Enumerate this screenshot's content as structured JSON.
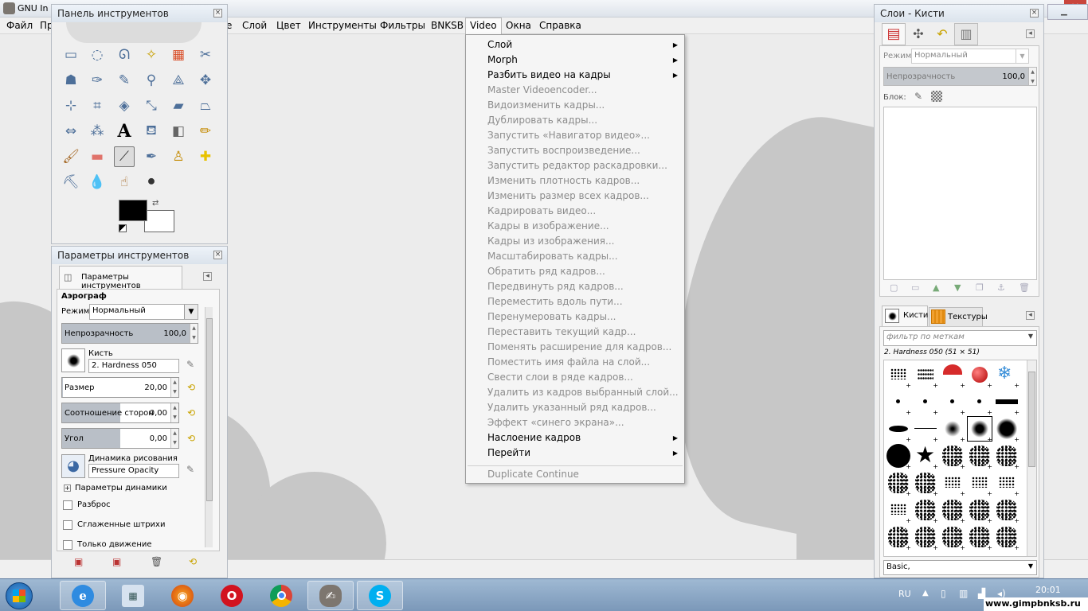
{
  "app": {
    "title": "GNU In",
    "menu": [
      "Файл",
      "Пр",
      "е",
      "Слой",
      "Цвет",
      "Инструменты",
      "Фильтры",
      "BNKSB",
      "Video",
      "Окна",
      "Справка"
    ]
  },
  "toolbox": {
    "title": "Панель инструментов",
    "close": "⊠"
  },
  "tool_options": {
    "title": "Параметры инструментов",
    "tab_label": "Параметры инструментов",
    "tool_name": "Аэрограф",
    "mode_label": "Режим:",
    "mode_value": "Нормальный",
    "opacity_label": "Непрозрачность",
    "opacity_value": "100,0",
    "brush_label": "Кисть",
    "brush_value": "2. Hardness 050",
    "size_label": "Размер",
    "size_value": "20,00",
    "aspect_label": "Соотношение сторон",
    "aspect_value": "0,00",
    "angle_label": "Угол",
    "angle_value": "0,00",
    "dynamics_label": "Динамика рисования",
    "dynamics_value": "Pressure Opacity",
    "dynamics_options_label": "Параметры динамики",
    "jitter_label": "Разброс",
    "smooth_label": "Сглаженные штрихи",
    "motion_label": "Только движение"
  },
  "video_menu": {
    "items": [
      {
        "label": "Слой",
        "enabled": true,
        "submenu": true
      },
      {
        "label": "Morph",
        "enabled": true,
        "submenu": true
      },
      {
        "label": "Разбить видео на кадры",
        "enabled": true,
        "submenu": true
      },
      {
        "label": "Master Videoencoder...",
        "enabled": false
      },
      {
        "label": "Видоизменить кадры...",
        "enabled": false
      },
      {
        "label": "Дублировать кадры...",
        "enabled": false
      },
      {
        "label": "Запустить «Навигатор видео»...",
        "enabled": false
      },
      {
        "label": "Запустить воспроизведение...",
        "enabled": false
      },
      {
        "label": "Запустить редактор раскадровки...",
        "enabled": false
      },
      {
        "label": "Изменить плотность кадров...",
        "enabled": false
      },
      {
        "label": "Изменить размер всех кадров...",
        "enabled": false
      },
      {
        "label": "Кадрировать видео...",
        "enabled": false
      },
      {
        "label": "Кадры в изображение...",
        "enabled": false
      },
      {
        "label": "Кадры из изображения...",
        "enabled": false
      },
      {
        "label": "Масштабировать кадры...",
        "enabled": false
      },
      {
        "label": "Обратить ряд кадров...",
        "enabled": false
      },
      {
        "label": "Передвинуть ряд кадров...",
        "enabled": false
      },
      {
        "label": "Переместить вдоль пути...",
        "enabled": false
      },
      {
        "label": "Перенумеровать кадры...",
        "enabled": false
      },
      {
        "label": "Переставить текущий кадр...",
        "enabled": false
      },
      {
        "label": "Поменять расширение для кадров...",
        "enabled": false
      },
      {
        "label": "Поместить имя файла на слой...",
        "enabled": false
      },
      {
        "label": "Свести слои в ряде кадров...",
        "enabled": false
      },
      {
        "label": "Удалить из кадров выбранный слой...",
        "enabled": false
      },
      {
        "label": "Удалить указанный ряд кадров...",
        "enabled": false
      },
      {
        "label": "Эффект «синего экрана»...",
        "enabled": false
      },
      {
        "label": "Наслоение кадров",
        "enabled": true,
        "submenu": true
      },
      {
        "label": "Перейти",
        "enabled": true,
        "submenu": true
      }
    ],
    "last_item": "Duplicate Continue"
  },
  "layers_dock": {
    "title": "Слои - Кисти",
    "mode_label": "Режим:",
    "mode_value": "Нормальный",
    "opacity_label": "Непрозрачность",
    "opacity_value": "100,0",
    "lock_label": "Блок:"
  },
  "brushes_dock": {
    "tab_brushes": "Кисти",
    "tab_textures": "Текстуры",
    "filter_placeholder": "фильтр по меткам",
    "selected_brush": "2. Hardness 050 (51 × 51)",
    "preset": "Basic,"
  },
  "taskbar": {
    "lang": "RU",
    "time": "20:01",
    "watermark": "www.gimpbnksb.ru"
  }
}
